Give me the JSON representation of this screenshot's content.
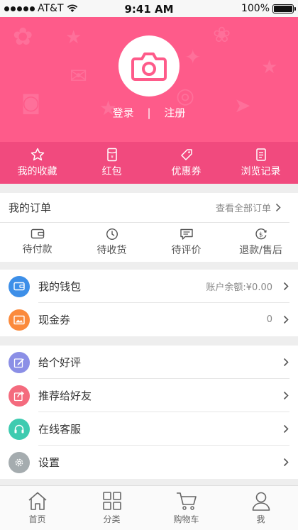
{
  "status": {
    "carrier": "AT&T",
    "time": "9:41 AM",
    "battery": "100%"
  },
  "header": {
    "login": "登录",
    "separator": "|",
    "register": "注册"
  },
  "quick_links": [
    {
      "label": "我的收藏",
      "icon": "star-icon"
    },
    {
      "label": "红包",
      "icon": "red-envelope-icon"
    },
    {
      "label": "优惠券",
      "icon": "coupon-tag-icon"
    },
    {
      "label": "浏览记录",
      "icon": "history-icon"
    }
  ],
  "orders": {
    "title": "我的订单",
    "view_all": "查看全部订单",
    "items": [
      {
        "label": "待付款",
        "icon": "wallet-icon"
      },
      {
        "label": "待收货",
        "icon": "clock-icon"
      },
      {
        "label": "待评价",
        "icon": "comment-icon"
      },
      {
        "label": "退款/售后",
        "icon": "refund-icon"
      }
    ]
  },
  "wallet": {
    "items": [
      {
        "label": "我的钱包",
        "value": "账户余额:¥0.00",
        "icon": "wallet-icon",
        "color": "#3d8fe8"
      },
      {
        "label": "现金券",
        "value": "0",
        "icon": "voucher-icon",
        "color": "#fb8a3c"
      }
    ]
  },
  "more": {
    "items": [
      {
        "label": "给个好评",
        "icon": "edit-icon",
        "color": "#8b8fe6"
      },
      {
        "label": "推荐给好友",
        "icon": "share-icon",
        "color": "#f46b7e"
      },
      {
        "label": "在线客服",
        "icon": "headset-icon",
        "color": "#3ecbb0"
      },
      {
        "label": "设置",
        "icon": "gear-icon",
        "color": "#a5acaf"
      }
    ]
  },
  "tabbar": [
    {
      "label": "首页",
      "icon": "home-icon"
    },
    {
      "label": "分类",
      "icon": "grid-icon"
    },
    {
      "label": "购物车",
      "icon": "cart-icon"
    },
    {
      "label": "我",
      "icon": "user-icon"
    }
  ]
}
